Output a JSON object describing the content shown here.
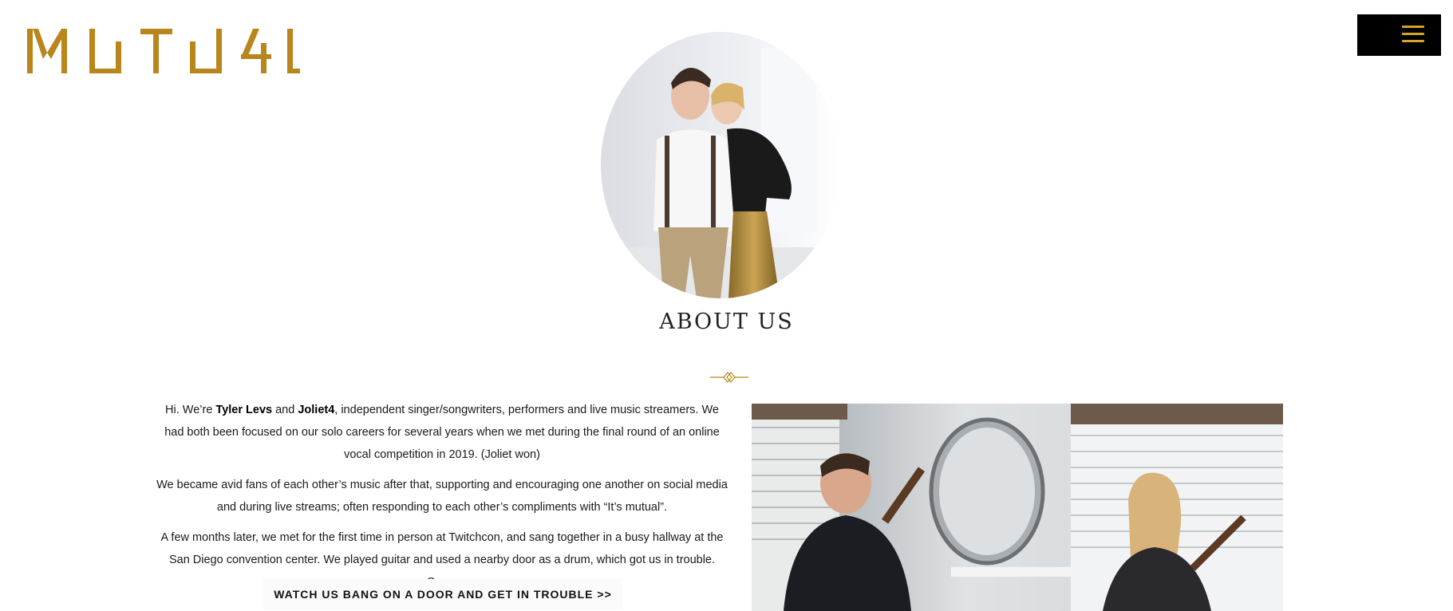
{
  "brand": {
    "logo_text": "MUTU4L",
    "accent": "#b8861c"
  },
  "header": {
    "menu_icon": "hamburger-menu-icon",
    "menu_bg": "#000000",
    "menu_accent": "#d4a52c"
  },
  "about": {
    "title": "ABOUT US",
    "paragraph1": {
      "intro": "Hi. We’re ",
      "name1": "Tyler Levs",
      "and": " and ",
      "name2": "Joliet4",
      "rest": ", independent singer/songwriters, performers and live music streamers. We had both been focused on our solo careers for several years when we met during the final round of an online vocal competition in 2019. (Joliet won)"
    },
    "paragraph2": "We became avid fans of each other’s music after that, supporting and encouraging one another on social media and during live streams; often responding to each other’s compliments with “It’s mutual”.",
    "paragraph3": "A few months later, we met for the first time in person at Twitchcon, and sang together in a busy hallway at the San Diego convention center. We played guitar and used a nearby door as a drum, which got us in trouble. Oops.",
    "cta_label": "WATCH US BANG ON A DOOR AND GET IN TROUBLE >>"
  }
}
